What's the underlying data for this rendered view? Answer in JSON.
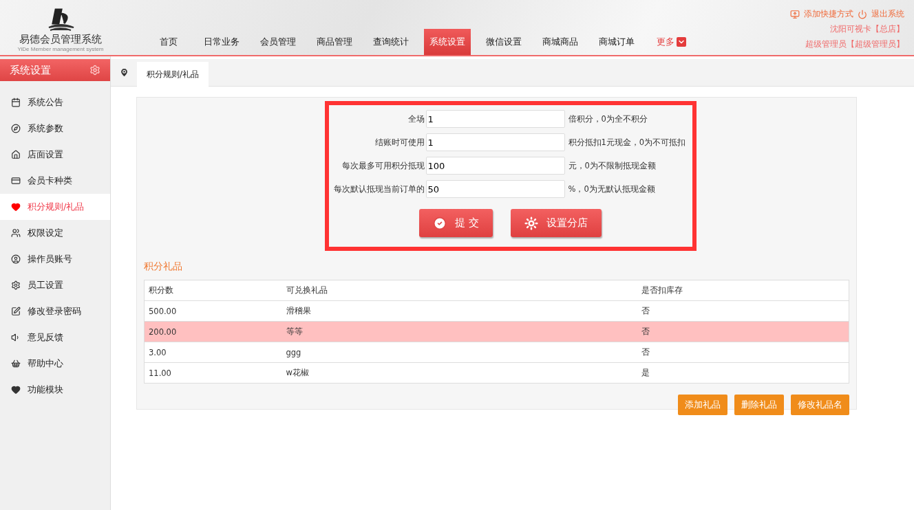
{
  "logo": {
    "title": "易德会员管理系统",
    "subtitle": "YiDe Member management system"
  },
  "nav": [
    {
      "label": "首页",
      "selected": false
    },
    {
      "label": "日常业务",
      "selected": false
    },
    {
      "label": "会员管理",
      "selected": false
    },
    {
      "label": "商品管理",
      "selected": false
    },
    {
      "label": "查询统计",
      "selected": false
    },
    {
      "label": "系统设置",
      "selected": true
    },
    {
      "label": "微信设置",
      "selected": false
    },
    {
      "label": "商城商品",
      "selected": false
    },
    {
      "label": "商城订单",
      "selected": false
    }
  ],
  "more": "更多",
  "user": {
    "shortcut": "添加快捷方式",
    "logout": "退出系统",
    "store": "沈阳可视卡【总店】",
    "role": "超级管理员【超级管理员】"
  },
  "sidebar": {
    "title": "系统设置",
    "items": [
      {
        "label": "系统公告",
        "selected": false
      },
      {
        "label": "系统参数",
        "selected": false
      },
      {
        "label": "店面设置",
        "selected": false
      },
      {
        "label": "会员卡种类",
        "selected": false
      },
      {
        "label": "积分规则/礼品",
        "selected": true
      },
      {
        "label": "权限设定",
        "selected": false
      },
      {
        "label": "操作员账号",
        "selected": false
      },
      {
        "label": "员工设置",
        "selected": false
      },
      {
        "label": "修改登录密码",
        "selected": false
      },
      {
        "label": "意见反馈",
        "selected": false
      },
      {
        "label": "帮助中心",
        "selected": false
      },
      {
        "label": "功能模块",
        "selected": false
      }
    ]
  },
  "tab": "积分规则/礼品",
  "form": {
    "fields": [
      {
        "label": "全场",
        "value": "1",
        "hint": "倍积分，0为全不积分"
      },
      {
        "label": "结账时可使用",
        "value": "1",
        "hint": "积分抵扣1元现金，0为不可抵扣"
      },
      {
        "label": "每次最多可用积分抵现",
        "value": "100",
        "hint": "元，0为不限制抵现金额"
      },
      {
        "label": "每次默认抵现当前订单的",
        "value": "50",
        "hint": "%，0为无默认抵现金额"
      }
    ],
    "submit": "提 交",
    "branch": "设置分店"
  },
  "gifts": {
    "title": "积分礼品",
    "columns": [
      "积分数",
      "可兑换礼品",
      "是否扣库存"
    ],
    "rows": [
      {
        "cells": [
          "500.00",
          "滑稽果",
          "否"
        ],
        "selected": false
      },
      {
        "cells": [
          "200.00",
          "等等",
          "否"
        ],
        "selected": true
      },
      {
        "cells": [
          "3.00",
          "ggg",
          "否"
        ],
        "selected": false
      },
      {
        "cells": [
          "11.00",
          "w花椒",
          "是"
        ],
        "selected": false
      }
    ],
    "buttons": [
      "添加礼品",
      "删除礼品",
      "修改礼品名"
    ]
  }
}
